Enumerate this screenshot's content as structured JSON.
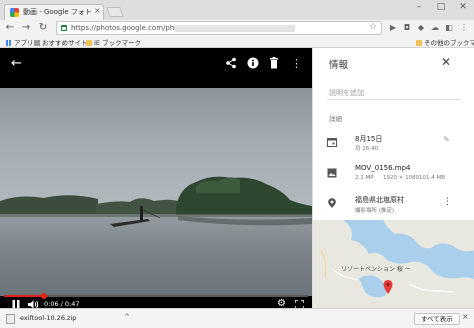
{
  "browser": {
    "tab_title": "動画 - Google フォト",
    "tab_close": "×",
    "window_minimize": "–",
    "window_maximize": "□",
    "window_close": "✕",
    "url": "https://photos.google.com/photo/"
  },
  "bookmarks": {
    "items": [
      {
        "label": "アプリ"
      },
      {
        "label": "おすすめサイト"
      },
      {
        "label": "IE ブックマーク"
      }
    ],
    "other": "その他のブックマーク"
  },
  "viewer": {
    "time_display": "0:06 / 0:47",
    "progress": 0.13
  },
  "info": {
    "title": "情報",
    "close": "✕",
    "description_placeholder": "説明を追加",
    "details_label": "詳細",
    "date_main": "8月15日",
    "date_sub": "月 16:40",
    "file_name": "MOV_0156.mp4",
    "file_meta_mp": "2.1 MP",
    "file_meta_res": "1920 × 1080",
    "file_meta_size": "101.4 MB",
    "location_main": "福島県北塩原村",
    "location_sub": "撮影場所 (推定)",
    "map_label": "リゾートペンション 桜 ー"
  },
  "download": {
    "file_name": "exiftool-10.26.zip",
    "caret": "^",
    "show_all": "すべて表示",
    "close": "×"
  },
  "colors": {
    "accent_red": "#e62117",
    "map_water": "#a9cfec",
    "map_land": "#e8e8e0"
  }
}
